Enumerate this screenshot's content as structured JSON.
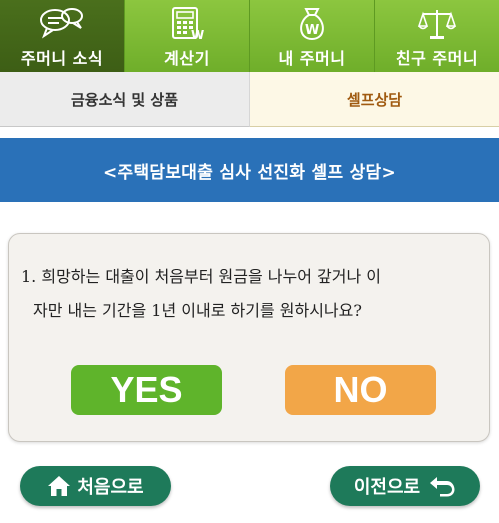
{
  "topnav": {
    "items": [
      {
        "label": "주머니 소식",
        "icon": "chat-bubbles-icon",
        "active": true
      },
      {
        "label": "계산기",
        "icon": "calculator-icon",
        "active": false
      },
      {
        "label": "내 주머니",
        "icon": "money-bag-icon",
        "active": false
      },
      {
        "label": "친구 주머니",
        "icon": "scales-icon",
        "active": false
      }
    ]
  },
  "subtabs": {
    "left": "금융소식 및 상품",
    "right": "셀프상담"
  },
  "banner": {
    "title": "<주택담보대출 심사 선진화 셀프 상담>"
  },
  "question": {
    "line1": "1. 희망하는 대출이 처음부터 원금을 나누어 갚거나 이",
    "line2": "자만 내는 기간을 1년 이내로 하기를 원하시나요?"
  },
  "answers": {
    "yes": "YES",
    "no": "NO"
  },
  "footer": {
    "home_label": "처음으로",
    "prev_label": "이전으로"
  },
  "colors": {
    "nav_green": "#7ab833",
    "nav_active": "#44661a",
    "banner_blue": "#2a71b8",
    "yes_green": "#5fb42b",
    "no_orange": "#f2a648",
    "pill_green": "#1e7a5a"
  }
}
